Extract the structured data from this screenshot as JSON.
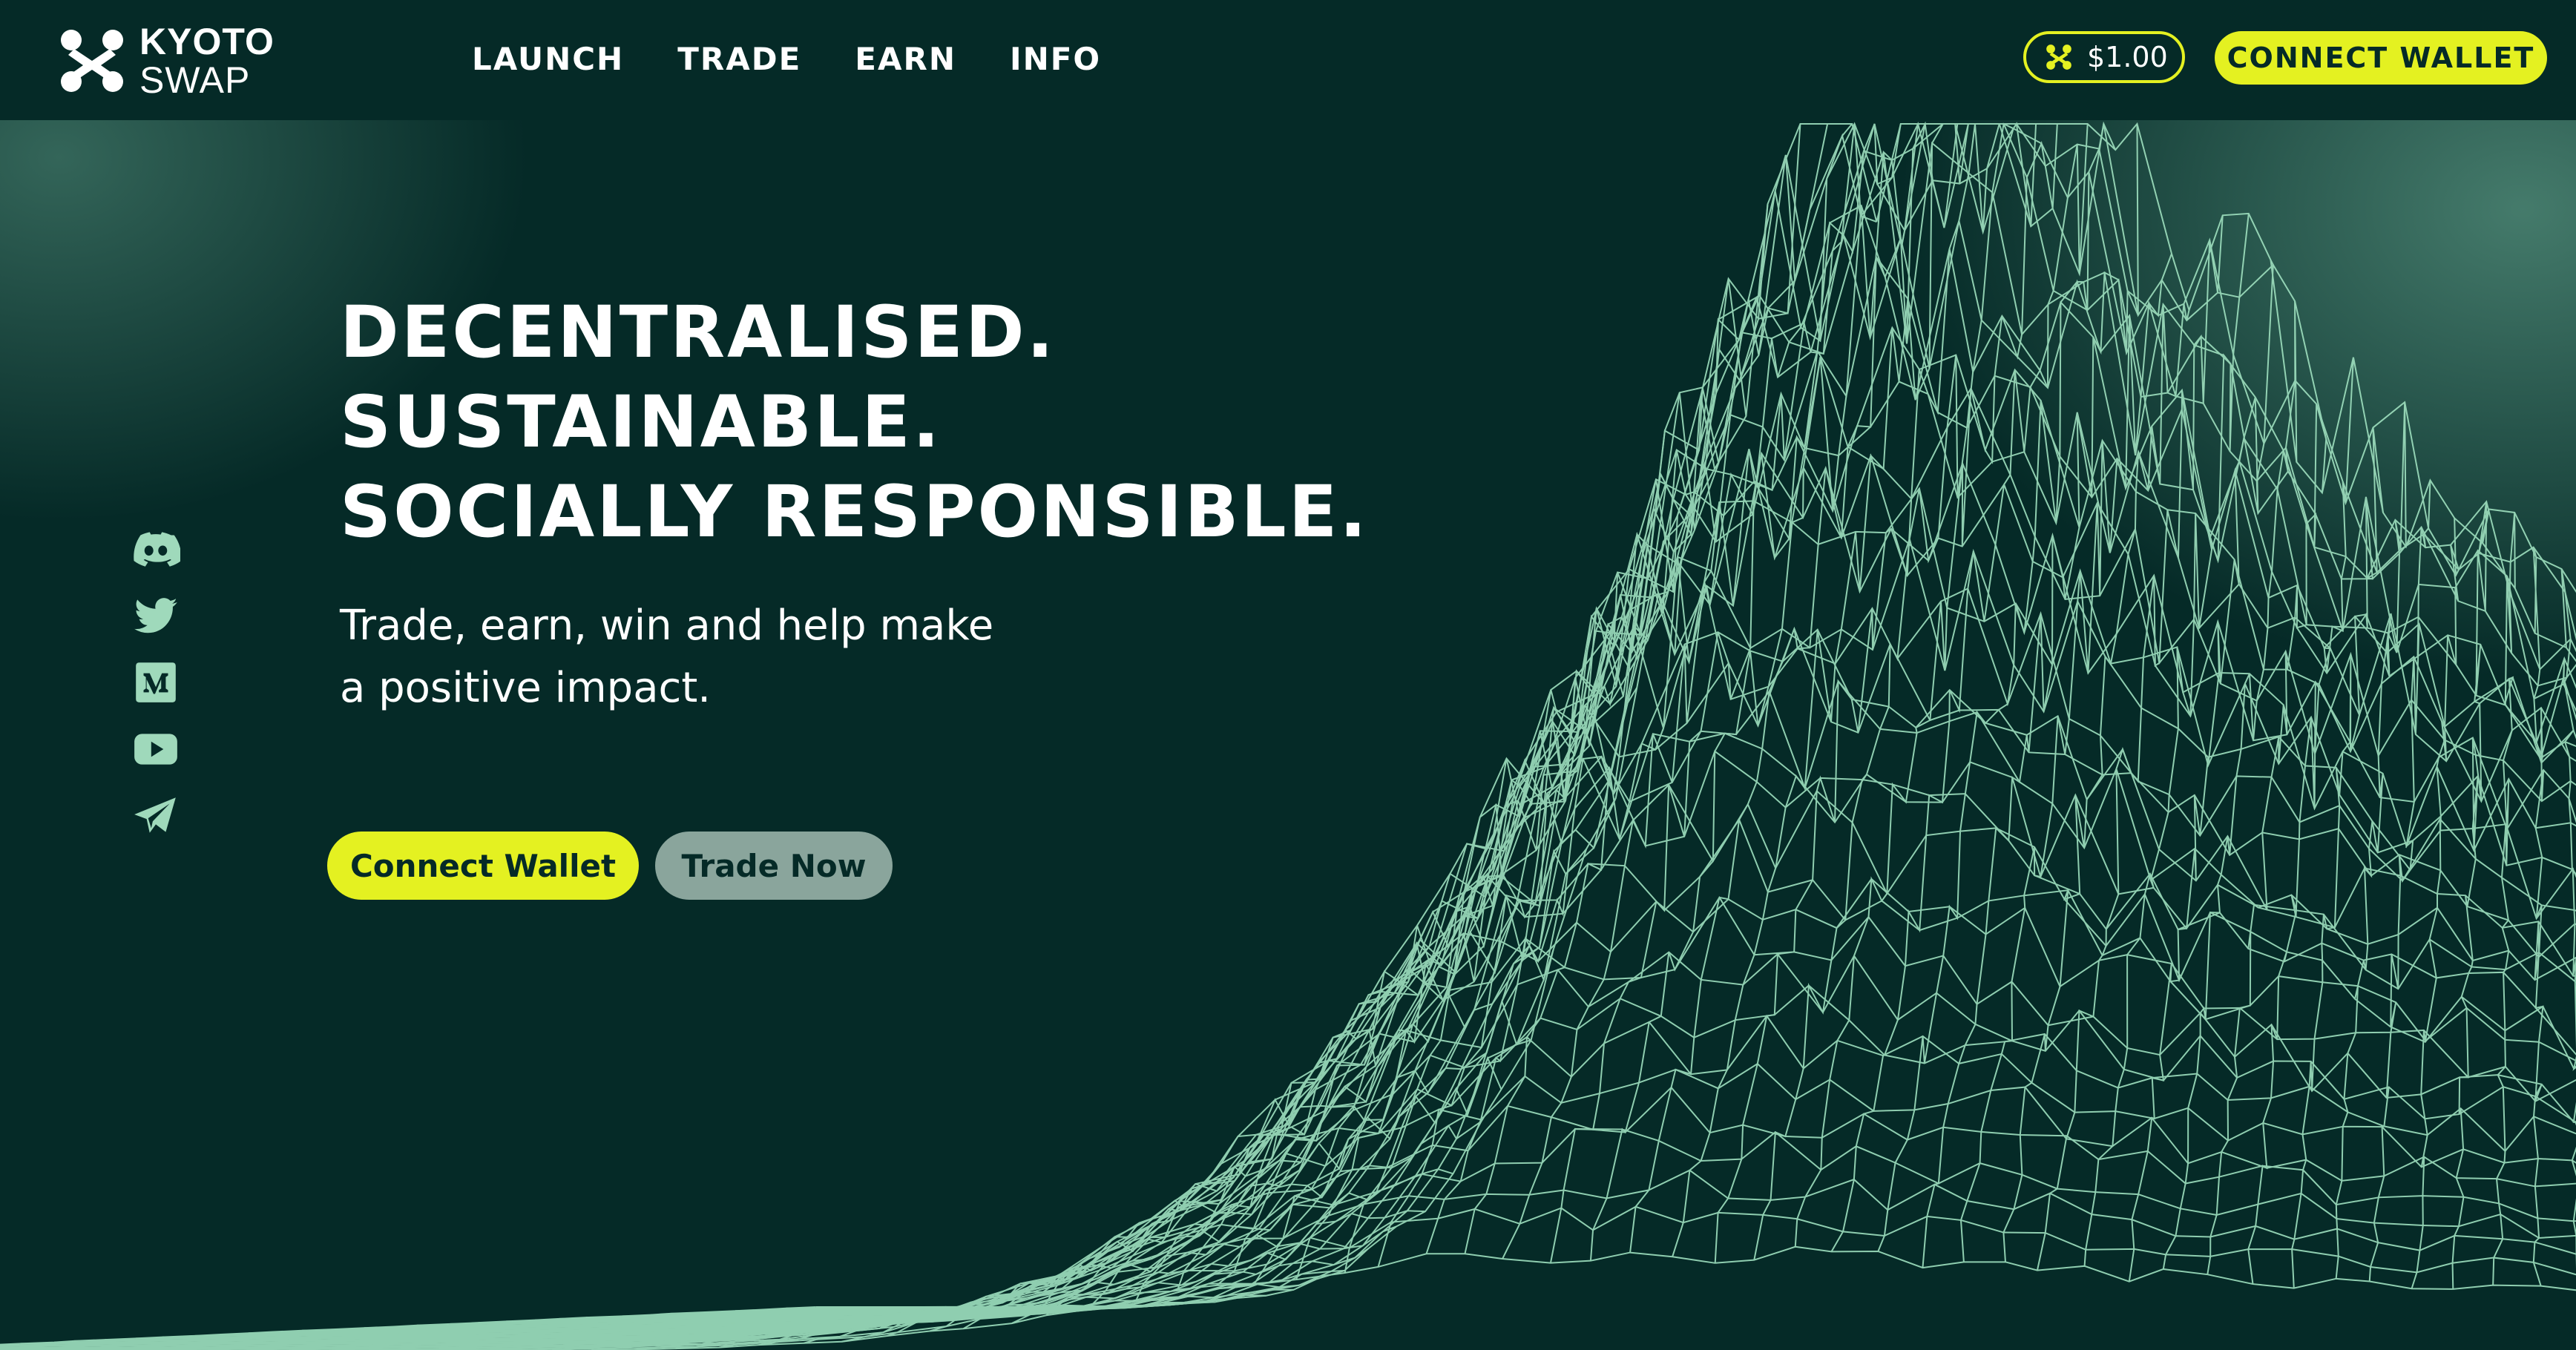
{
  "header": {
    "logo": {
      "line1": "KYOTO",
      "line2": "SWAP"
    },
    "nav": [
      {
        "label": "LAUNCH"
      },
      {
        "label": "TRADE"
      },
      {
        "label": "EARN"
      },
      {
        "label": "INFO"
      }
    ],
    "token_price": "$1.00",
    "connect_label": "CONNECT WALLET"
  },
  "hero": {
    "headline": [
      "DECENTRALISED.",
      "SUSTAINABLE.",
      "SOCIALLY RESPONSIBLE."
    ],
    "subhead": [
      "Trade, earn, win and help make",
      "a positive impact."
    ],
    "primary_button": "Connect Wallet",
    "secondary_button": "Trade Now"
  },
  "social_icons": [
    "discord-icon",
    "twitter-icon",
    "medium-icon",
    "youtube-icon",
    "telegram-icon"
  ],
  "colors": {
    "background": "#052a27",
    "accent": "#e4f121",
    "secondary_button": "#8aa59c",
    "wireframe": "#9fe0bf",
    "social_icon": "#9fd9bb"
  }
}
